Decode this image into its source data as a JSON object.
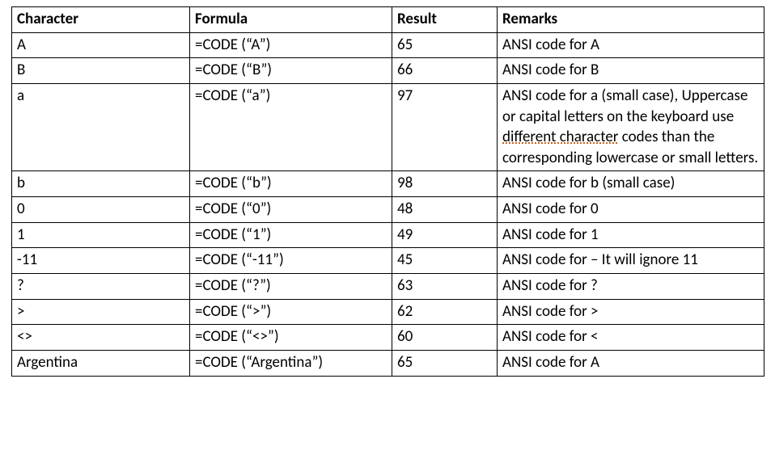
{
  "headers": {
    "character": "Character",
    "formula": "Formula",
    "result": "Result",
    "remarks": "Remarks"
  },
  "rows": [
    {
      "character": "A",
      "formula": "=CODE (“A”)",
      "result": "65",
      "remarks": "ANSI code for A"
    },
    {
      "character": "B",
      "formula": "=CODE (“B”)",
      "result": "66",
      "remarks": "ANSI code for B"
    },
    {
      "character": "a",
      "formula": "=CODE (“a”)",
      "result": "97",
      "remarks_pre": "ANSI code for a (small case), Uppercase or capital letters on the keyboard use ",
      "remarks_hint": "different character",
      "remarks_post": " codes than the corresponding lowercase or small letters."
    },
    {
      "character": "b",
      "formula": "=CODE (“b”)",
      "result": "98",
      "remarks": "ANSI code for b (small case)"
    },
    {
      "character": "0",
      "formula": "=CODE (“0”)",
      "result": "48",
      "remarks": "ANSI code for 0"
    },
    {
      "character": "1",
      "formula": "=CODE (“1”)",
      "result": "49",
      "remarks": "ANSI code for 1"
    },
    {
      "character": "-11",
      "formula": "=CODE (“-11”)",
      "result": "45",
      "remarks": "ANSI code for – It will ignore 11"
    },
    {
      "character": "?",
      "formula": "=CODE (“?”)",
      "result": "63",
      "remarks": "ANSI code for ?"
    },
    {
      "character": ">",
      "formula": "=CODE (“>”)",
      "result": "62",
      "remarks": "ANSI code for >"
    },
    {
      "character": "<>",
      "formula": "=CODE (“<>”)",
      "result": "60",
      "remarks": "ANSI code for <"
    },
    {
      "character": "Argentina",
      "formula": "=CODE (“Argentina”)",
      "result": "65",
      "remarks": "ANSI code for A"
    }
  ]
}
